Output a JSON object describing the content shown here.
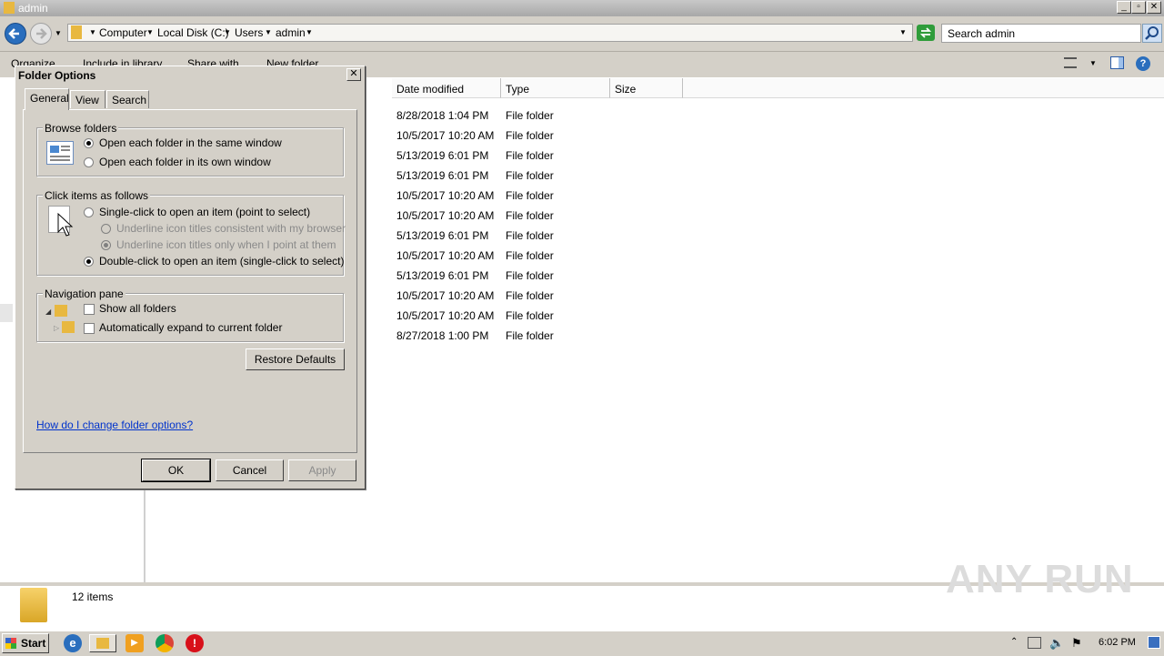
{
  "window": {
    "title": "admin"
  },
  "address": {
    "crumbs": [
      "Computer",
      "Local Disk (C:)",
      "Users",
      "admin"
    ],
    "search_placeholder": "Search admin"
  },
  "toolbar": {
    "organize": "Organize",
    "include_in_library": "Include in library",
    "share_with": "Share with",
    "new_folder": "New folder"
  },
  "columns": {
    "date_modified": "Date modified",
    "type": "Type",
    "size": "Size"
  },
  "files": [
    {
      "date": "8/28/2018 1:04 PM",
      "type": "File folder"
    },
    {
      "date": "10/5/2017 10:20 AM",
      "type": "File folder"
    },
    {
      "date": "5/13/2019 6:01 PM",
      "type": "File folder"
    },
    {
      "date": "5/13/2019 6:01 PM",
      "type": "File folder"
    },
    {
      "date": "10/5/2017 10:20 AM",
      "type": "File folder"
    },
    {
      "date": "10/5/2017 10:20 AM",
      "type": "File folder"
    },
    {
      "date": "5/13/2019 6:01 PM",
      "type": "File folder"
    },
    {
      "date": "10/5/2017 10:20 AM",
      "type": "File folder"
    },
    {
      "date": "5/13/2019 6:01 PM",
      "type": "File folder"
    },
    {
      "date": "10/5/2017 10:20 AM",
      "type": "File folder"
    },
    {
      "date": "10/5/2017 10:20 AM",
      "type": "File folder"
    },
    {
      "date": "8/27/2018 1:00 PM",
      "type": "File folder"
    }
  ],
  "status": {
    "item_count": "12 items"
  },
  "dialog": {
    "title": "Folder Options",
    "close": "✕",
    "tabs": [
      "General",
      "View",
      "Search"
    ],
    "browse": {
      "label": "Browse folders",
      "same_window": "Open each folder in the same window",
      "own_window": "Open each folder in its own window"
    },
    "click": {
      "label": "Click items as follows",
      "single": "Single-click to open an item (point to select)",
      "underline_browser": "Underline icon titles consistent with my browser",
      "underline_point": "Underline icon titles only when I point at them",
      "double": "Double-click to open an item (single-click to select)"
    },
    "nav": {
      "label": "Navigation pane",
      "show_all": "Show all folders",
      "auto_expand": "Automatically expand to current folder"
    },
    "restore": "Restore Defaults",
    "help_link": "How do I change folder options?",
    "ok": "OK",
    "cancel": "Cancel",
    "apply": "Apply"
  },
  "taskbar": {
    "start": "Start",
    "clock": "6:02 PM"
  },
  "watermark": "ANY RUN",
  "colors": {
    "link": "#0033cc",
    "face": "#d4d0c8"
  }
}
